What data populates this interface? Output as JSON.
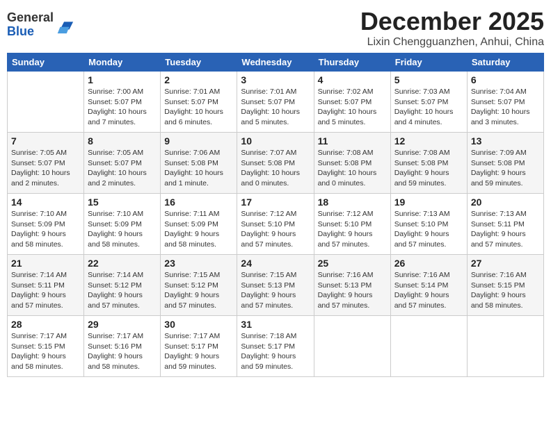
{
  "header": {
    "logo_line1": "General",
    "logo_line2": "Blue",
    "month": "December 2025",
    "location": "Lixin Chengguanzhen, Anhui, China"
  },
  "days_of_week": [
    "Sunday",
    "Monday",
    "Tuesday",
    "Wednesday",
    "Thursday",
    "Friday",
    "Saturday"
  ],
  "weeks": [
    [
      {
        "day": null
      },
      {
        "day": 1,
        "sunrise": "7:00 AM",
        "sunset": "5:07 PM",
        "daylight": "10 hours and 7 minutes."
      },
      {
        "day": 2,
        "sunrise": "7:01 AM",
        "sunset": "5:07 PM",
        "daylight": "10 hours and 6 minutes."
      },
      {
        "day": 3,
        "sunrise": "7:01 AM",
        "sunset": "5:07 PM",
        "daylight": "10 hours and 5 minutes."
      },
      {
        "day": 4,
        "sunrise": "7:02 AM",
        "sunset": "5:07 PM",
        "daylight": "10 hours and 5 minutes."
      },
      {
        "day": 5,
        "sunrise": "7:03 AM",
        "sunset": "5:07 PM",
        "daylight": "10 hours and 4 minutes."
      },
      {
        "day": 6,
        "sunrise": "7:04 AM",
        "sunset": "5:07 PM",
        "daylight": "10 hours and 3 minutes."
      }
    ],
    [
      {
        "day": 7,
        "sunrise": "7:05 AM",
        "sunset": "5:07 PM",
        "daylight": "10 hours and 2 minutes."
      },
      {
        "day": 8,
        "sunrise": "7:05 AM",
        "sunset": "5:07 PM",
        "daylight": "10 hours and 2 minutes."
      },
      {
        "day": 9,
        "sunrise": "7:06 AM",
        "sunset": "5:08 PM",
        "daylight": "10 hours and 1 minute."
      },
      {
        "day": 10,
        "sunrise": "7:07 AM",
        "sunset": "5:08 PM",
        "daylight": "10 hours and 0 minutes."
      },
      {
        "day": 11,
        "sunrise": "7:08 AM",
        "sunset": "5:08 PM",
        "daylight": "10 hours and 0 minutes."
      },
      {
        "day": 12,
        "sunrise": "7:08 AM",
        "sunset": "5:08 PM",
        "daylight": "9 hours and 59 minutes."
      },
      {
        "day": 13,
        "sunrise": "7:09 AM",
        "sunset": "5:08 PM",
        "daylight": "9 hours and 59 minutes."
      }
    ],
    [
      {
        "day": 14,
        "sunrise": "7:10 AM",
        "sunset": "5:09 PM",
        "daylight": "9 hours and 58 minutes."
      },
      {
        "day": 15,
        "sunrise": "7:10 AM",
        "sunset": "5:09 PM",
        "daylight": "9 hours and 58 minutes."
      },
      {
        "day": 16,
        "sunrise": "7:11 AM",
        "sunset": "5:09 PM",
        "daylight": "9 hours and 58 minutes."
      },
      {
        "day": 17,
        "sunrise": "7:12 AM",
        "sunset": "5:10 PM",
        "daylight": "9 hours and 57 minutes."
      },
      {
        "day": 18,
        "sunrise": "7:12 AM",
        "sunset": "5:10 PM",
        "daylight": "9 hours and 57 minutes."
      },
      {
        "day": 19,
        "sunrise": "7:13 AM",
        "sunset": "5:10 PM",
        "daylight": "9 hours and 57 minutes."
      },
      {
        "day": 20,
        "sunrise": "7:13 AM",
        "sunset": "5:11 PM",
        "daylight": "9 hours and 57 minutes."
      }
    ],
    [
      {
        "day": 21,
        "sunrise": "7:14 AM",
        "sunset": "5:11 PM",
        "daylight": "9 hours and 57 minutes."
      },
      {
        "day": 22,
        "sunrise": "7:14 AM",
        "sunset": "5:12 PM",
        "daylight": "9 hours and 57 minutes."
      },
      {
        "day": 23,
        "sunrise": "7:15 AM",
        "sunset": "5:12 PM",
        "daylight": "9 hours and 57 minutes."
      },
      {
        "day": 24,
        "sunrise": "7:15 AM",
        "sunset": "5:13 PM",
        "daylight": "9 hours and 57 minutes."
      },
      {
        "day": 25,
        "sunrise": "7:16 AM",
        "sunset": "5:13 PM",
        "daylight": "9 hours and 57 minutes."
      },
      {
        "day": 26,
        "sunrise": "7:16 AM",
        "sunset": "5:14 PM",
        "daylight": "9 hours and 57 minutes."
      },
      {
        "day": 27,
        "sunrise": "7:16 AM",
        "sunset": "5:15 PM",
        "daylight": "9 hours and 58 minutes."
      }
    ],
    [
      {
        "day": 28,
        "sunrise": "7:17 AM",
        "sunset": "5:15 PM",
        "daylight": "9 hours and 58 minutes."
      },
      {
        "day": 29,
        "sunrise": "7:17 AM",
        "sunset": "5:16 PM",
        "daylight": "9 hours and 58 minutes."
      },
      {
        "day": 30,
        "sunrise": "7:17 AM",
        "sunset": "5:17 PM",
        "daylight": "9 hours and 59 minutes."
      },
      {
        "day": 31,
        "sunrise": "7:18 AM",
        "sunset": "5:17 PM",
        "daylight": "9 hours and 59 minutes."
      },
      {
        "day": null
      },
      {
        "day": null
      },
      {
        "day": null
      }
    ]
  ]
}
